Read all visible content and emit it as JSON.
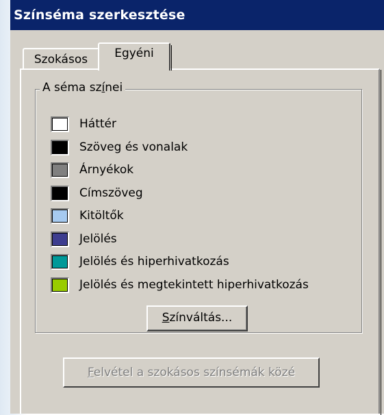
{
  "window": {
    "title": "Színséma szerkesztése"
  },
  "tabs": [
    {
      "label": "Szokásos",
      "active": false
    },
    {
      "label": "Egyéni",
      "active": true
    }
  ],
  "group": {
    "legend_prefix": "A séma sz",
    "legend_underlined": "í",
    "legend_suffix": "nei"
  },
  "colors": [
    {
      "label": "Háttér",
      "color": "#ffffff"
    },
    {
      "label": "Szöveg és vonalak",
      "color": "#000000"
    },
    {
      "label": "Árnyékok",
      "color": "#808080"
    },
    {
      "label": "Címszöveg",
      "color": "#000000"
    },
    {
      "label": "Kitöltők",
      "color": "#a6caf0"
    },
    {
      "label": "Jelölés",
      "color": "#3d3d8f"
    },
    {
      "label": "Jelölés és hiperhivatkozás",
      "color": "#009999"
    },
    {
      "label": "Jelölés és megtekintett hiperhivatkozás",
      "color": "#99cc00"
    }
  ],
  "buttons": {
    "change_underlined": "S",
    "change_rest": "zínváltás...",
    "add_underlined": "F",
    "add_rest": "elvétel a szokásos színsémák közé",
    "add_disabled": true
  }
}
